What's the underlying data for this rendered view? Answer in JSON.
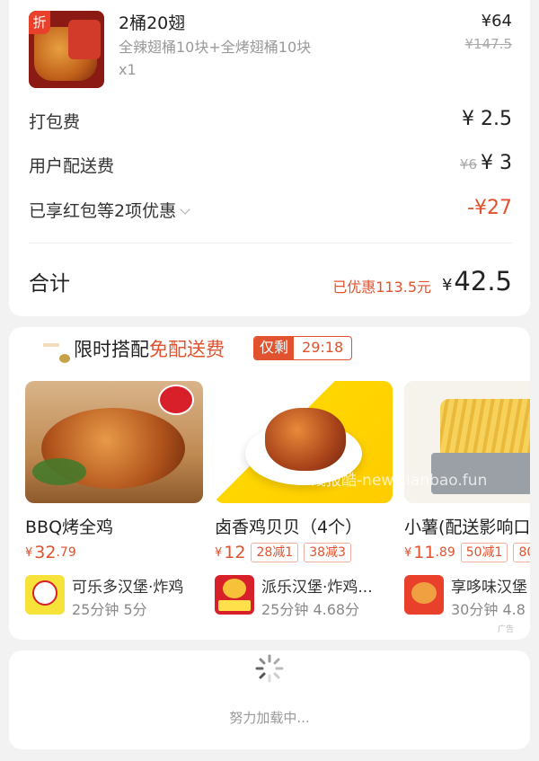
{
  "order_item": {
    "badge": "折",
    "title": "2桶20翅",
    "desc": "全辣翅桶10块+全烤翅桶10块",
    "qty": "x1",
    "price": "¥64",
    "orig_price": "¥147.5"
  },
  "fees": {
    "packing_label": "打包费",
    "packing_value": "¥ 2.5",
    "delivery_label": "用户配送费",
    "delivery_old": "¥6",
    "delivery_value": "¥ 3",
    "discount_label": "已享红包等2项优惠",
    "discount_value": "-¥27"
  },
  "total": {
    "label": "合计",
    "saved": "已优惠113.5元",
    "currency": "¥",
    "amount": "42.5"
  },
  "promo": {
    "title_prefix": "限时搭配",
    "title_highlight": "免配送费",
    "timer_tag": "仅剩",
    "timer_value": "29:18",
    "ad_label": "广告",
    "watermark": "线报酷-new.xianbao.fun"
  },
  "products": [
    {
      "name": "BBQ烤全鸡",
      "price_currency": "¥",
      "price_int": "32",
      "price_dec": ".79",
      "tags": [],
      "store_name": "可乐多汉堡·炸鸡",
      "store_meta": "25分钟  5分"
    },
    {
      "name": "卤香鸡贝贝（4个）",
      "price_currency": "¥",
      "price_int": "12",
      "price_dec": "",
      "tags": [
        "28减1",
        "38减3"
      ],
      "store_name": "派乐汉堡·炸鸡...",
      "store_meta": "25分钟  4.68分"
    },
    {
      "name": "小薯(配送影响口",
      "price_currency": "¥",
      "price_int": "11",
      "price_dec": ".89",
      "tags": [
        "50减1",
        "80"
      ],
      "store_name": "享哆味汉堡",
      "store_meta": "30分钟  4.8"
    }
  ],
  "loading": {
    "text": "努力加载中..."
  },
  "colors": {
    "accent": "#e0532e",
    "background": "#f2f2f2"
  }
}
